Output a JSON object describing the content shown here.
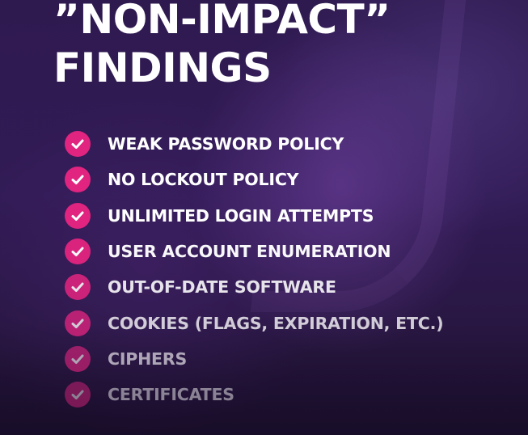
{
  "heading": {
    "line1": "”NON-IMPACT”",
    "line2": "FINDINGS"
  },
  "colors": {
    "background": "#2a1745",
    "check_fill": "#e0247f",
    "text": "#ffffff"
  },
  "items": [
    {
      "label": "WEAK PASSWORD POLICY",
      "icon": "check-circle-icon",
      "opacity": 1.0
    },
    {
      "label": "NO LOCKOUT POLICY",
      "icon": "check-circle-icon",
      "opacity": 1.0
    },
    {
      "label": "UNLIMITED LOGIN ATTEMPTS",
      "icon": "check-circle-icon",
      "opacity": 1.0
    },
    {
      "label": "USER ACCOUNT ENUMERATION",
      "icon": "check-circle-icon",
      "opacity": 0.97
    },
    {
      "label": "OUT-OF-DATE SOFTWARE",
      "icon": "check-circle-icon",
      "opacity": 0.88
    },
    {
      "label": "COOKIES (FLAGS, EXPIRATION, ETC.)",
      "icon": "check-circle-icon",
      "opacity": 0.78
    },
    {
      "label": "CIPHERS",
      "icon": "check-circle-icon",
      "opacity": 0.62
    },
    {
      "label": "CERTIFICATES",
      "icon": "check-circle-icon",
      "opacity": 0.48
    }
  ]
}
